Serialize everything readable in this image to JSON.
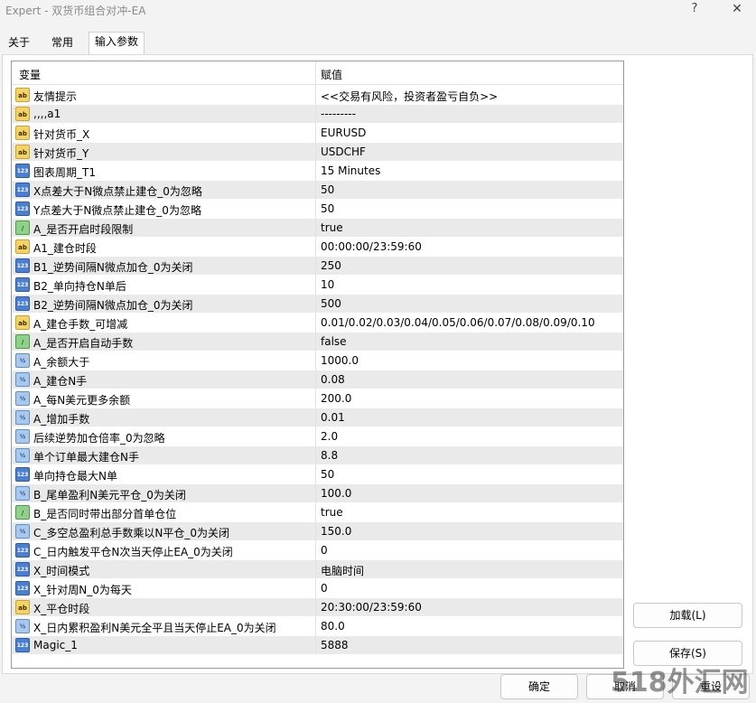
{
  "window": {
    "title": "Expert - 双货币组合对冲-EA",
    "help": "?",
    "close": "✕"
  },
  "tabs": [
    {
      "label": "关于",
      "active": false
    },
    {
      "label": "常用",
      "active": false
    },
    {
      "label": "输入参数",
      "active": true
    }
  ],
  "table": {
    "headers": {
      "name": "变量",
      "value": "赋值"
    },
    "rows": [
      {
        "icon": "ab",
        "name": "友情提示",
        "value": "<<交易有风险，投资者盈亏自负>>"
      },
      {
        "icon": "ab",
        "name": ",,,,a1",
        "value": "---------"
      },
      {
        "icon": "ab",
        "name": "针对货币_X",
        "value": "EURUSD"
      },
      {
        "icon": "ab",
        "name": "针对货币_Y",
        "value": "USDCHF"
      },
      {
        "icon": "123",
        "name": "图表周期_T1",
        "value": "15 Minutes"
      },
      {
        "icon": "123",
        "name": "X点差大于N微点禁止建仓_0为忽略",
        "value": "50"
      },
      {
        "icon": "123",
        "name": "Y点差大于N微点禁止建仓_0为忽略",
        "value": "50"
      },
      {
        "icon": "bool",
        "name": "A_是否开启时段限制",
        "value": "true"
      },
      {
        "icon": "ab",
        "name": "A1_建仓时段",
        "value": "00:00:00/23:59:60"
      },
      {
        "icon": "123",
        "name": "B1_逆势间隔N微点加仓_0为关闭",
        "value": "250"
      },
      {
        "icon": "123",
        "name": "B2_单向持仓N单后",
        "value": "10"
      },
      {
        "icon": "123",
        "name": "B2_逆势间隔N微点加仓_0为关闭",
        "value": "500"
      },
      {
        "icon": "ab",
        "name": "A_建仓手数_可增减",
        "value": "0.01/0.02/0.03/0.04/0.05/0.06/0.07/0.08/0.09/0.10"
      },
      {
        "icon": "bool",
        "name": "A_是否开启自动手数",
        "value": "false"
      },
      {
        "icon": "dbl",
        "name": "A_余额大于",
        "value": "1000.0"
      },
      {
        "icon": "dbl",
        "name": "A_建仓N手",
        "value": "0.08"
      },
      {
        "icon": "dbl",
        "name": "A_每N美元更多余额",
        "value": "200.0"
      },
      {
        "icon": "dbl",
        "name": "A_增加手数",
        "value": "0.01"
      },
      {
        "icon": "dbl",
        "name": "后续逆势加仓倍率_0为忽略",
        "value": "2.0"
      },
      {
        "icon": "dbl",
        "name": "单个订单最大建仓N手",
        "value": "8.8"
      },
      {
        "icon": "123",
        "name": "单向持仓最大N单",
        "value": "50"
      },
      {
        "icon": "dbl",
        "name": "B_尾单盈利N美元平仓_0为关闭",
        "value": "100.0"
      },
      {
        "icon": "bool",
        "name": "B_是否同时带出部分首单仓位",
        "value": "true"
      },
      {
        "icon": "dbl",
        "name": "C_多空总盈利总手数乘以N平仓_0为关闭",
        "value": "150.0"
      },
      {
        "icon": "123",
        "name": "C_日内触发平仓N次当天停止EA_0为关闭",
        "value": "0"
      },
      {
        "icon": "123",
        "name": "X_时间模式",
        "value": "电脑时间"
      },
      {
        "icon": "123",
        "name": "X_针对周N_0为每天",
        "value": "0"
      },
      {
        "icon": "ab",
        "name": "X_平仓时段",
        "value": "20:30:00/23:59:60"
      },
      {
        "icon": "dbl",
        "name": "X_日内累积盈利N美元全平且当天停止EA_0为关闭",
        "value": "80.0"
      },
      {
        "icon": "123",
        "name": "Magic_1",
        "value": "5888"
      }
    ]
  },
  "buttons": {
    "load": "加载(L)",
    "save": "保存(S)",
    "ok": "确定",
    "cancel": "取消",
    "reset": "重设"
  },
  "icon_text": {
    "ab": "ab",
    "123": "123",
    "bool": "∕",
    "dbl": "½"
  },
  "watermark": "518外汇网"
}
